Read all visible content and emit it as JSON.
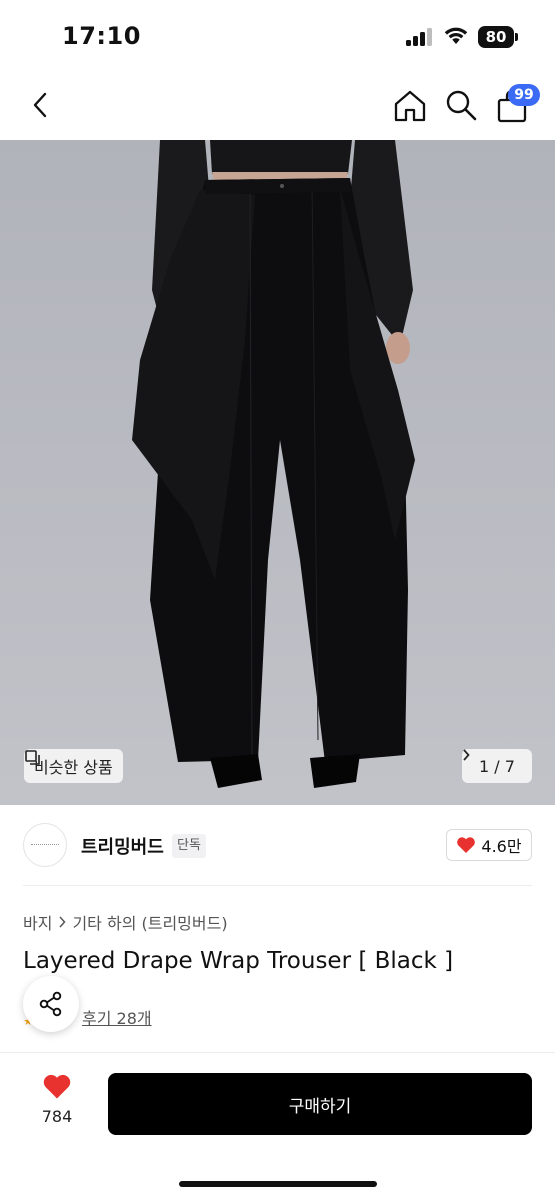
{
  "status_bar": {
    "time": "17:10",
    "battery": "80"
  },
  "nav": {
    "cart_badge": "99"
  },
  "hero": {
    "similar_label": "비슷한 상품",
    "counter": "1 / 7"
  },
  "store": {
    "name": "트리밍버드",
    "tag": "단독",
    "likes": "4.6만"
  },
  "breadcrumb": {
    "category": "바지",
    "subcategory": "기타 하의 (트리밍버드)"
  },
  "product": {
    "title": "Layered Drape Wrap Trouser [ Black ]",
    "reviews": "후기 28개"
  },
  "bottom": {
    "wish_count": "784",
    "buy_label": "구매하기"
  },
  "colors": {
    "badge": "#3b6bf5",
    "heart": "#e8322f",
    "buy": "#000000"
  }
}
